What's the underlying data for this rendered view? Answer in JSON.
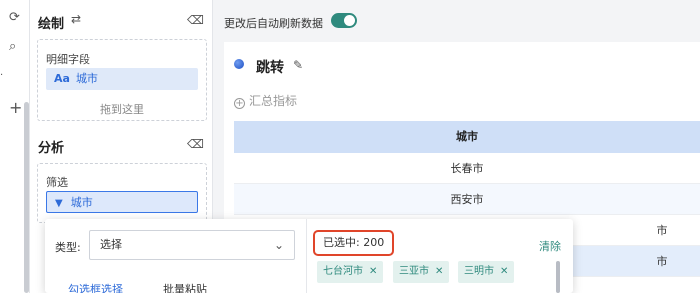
{
  "left_strip": {
    "icons": [
      "refresh-icon",
      "search-doc-icon",
      "add-icon"
    ]
  },
  "panel": {
    "draw_section": {
      "title": "绘制",
      "detail_box": {
        "label": "明细字段",
        "field": {
          "type_badge": "Aa",
          "name": "城市"
        },
        "drop_hint": "拖到这里"
      }
    },
    "analysis_section": {
      "title": "分析",
      "filter_box": {
        "label": "筛选",
        "field": {
          "name": "城市"
        }
      }
    }
  },
  "main": {
    "refresh_label": "更改后自动刷新数据",
    "refresh_enabled": true,
    "card": {
      "title": "跳转",
      "add_metric": "汇总指标",
      "table": {
        "header": "城市",
        "rows": [
          "长春市",
          "西安市",
          "市",
          "市"
        ]
      }
    }
  },
  "popup": {
    "type_label": "类型:",
    "type_value": "选择",
    "tabs": [
      "勾选框选择",
      "批量粘贴"
    ],
    "selected_count_text": "已选中: 200",
    "clear_label": "清除",
    "selected_tags": [
      "七台河市",
      "三亚市",
      "三明市"
    ]
  },
  "colors": {
    "accent_blue": "#2e6bd8",
    "accent_teal": "#2f8a7e",
    "highlight_red": "#e0452a",
    "table_header_bg": "#cfdff7"
  }
}
